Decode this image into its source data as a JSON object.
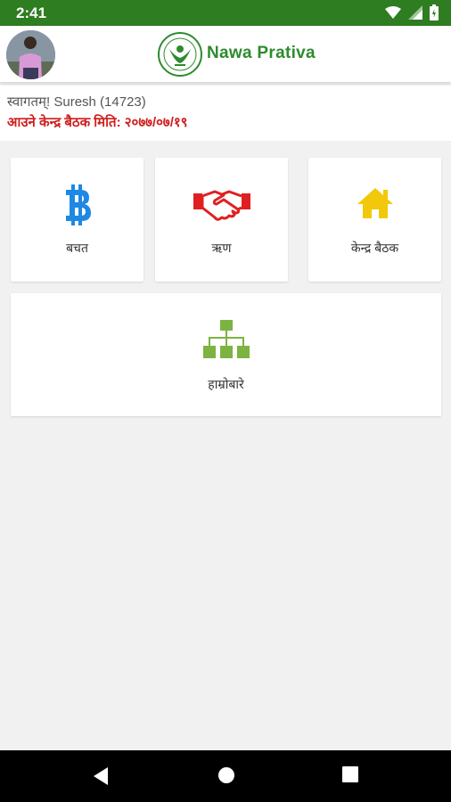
{
  "status_bar": {
    "time": "2:41",
    "icons": [
      "wifi-icon",
      "signal-icon",
      "battery-icon"
    ],
    "color": "#2e7d20"
  },
  "header": {
    "brand": "Nawa Prativa",
    "brand_color": "#2e8b2e"
  },
  "welcome": {
    "greeting": "स्वागतम्! Suresh (14723)",
    "next_meeting": "आउने केन्द्र बैठक मिति: २०७७/०७/१९",
    "meeting_color": "#d01f1f"
  },
  "tiles": [
    {
      "label": "बचत",
      "icon": "bitcoin-icon",
      "color": "#1e88e5"
    },
    {
      "label": "ऋण",
      "icon": "handshake-icon",
      "color": "#e02020"
    },
    {
      "label": "केन्द्र बैठक",
      "icon": "home-icon",
      "color": "#f2c90a"
    },
    {
      "label": "हाम्रोबारे",
      "icon": "org-chart-icon",
      "color": "#7cb342"
    }
  ],
  "nav": {
    "buttons": [
      "back-icon",
      "home-circle-icon",
      "recents-icon"
    ]
  }
}
